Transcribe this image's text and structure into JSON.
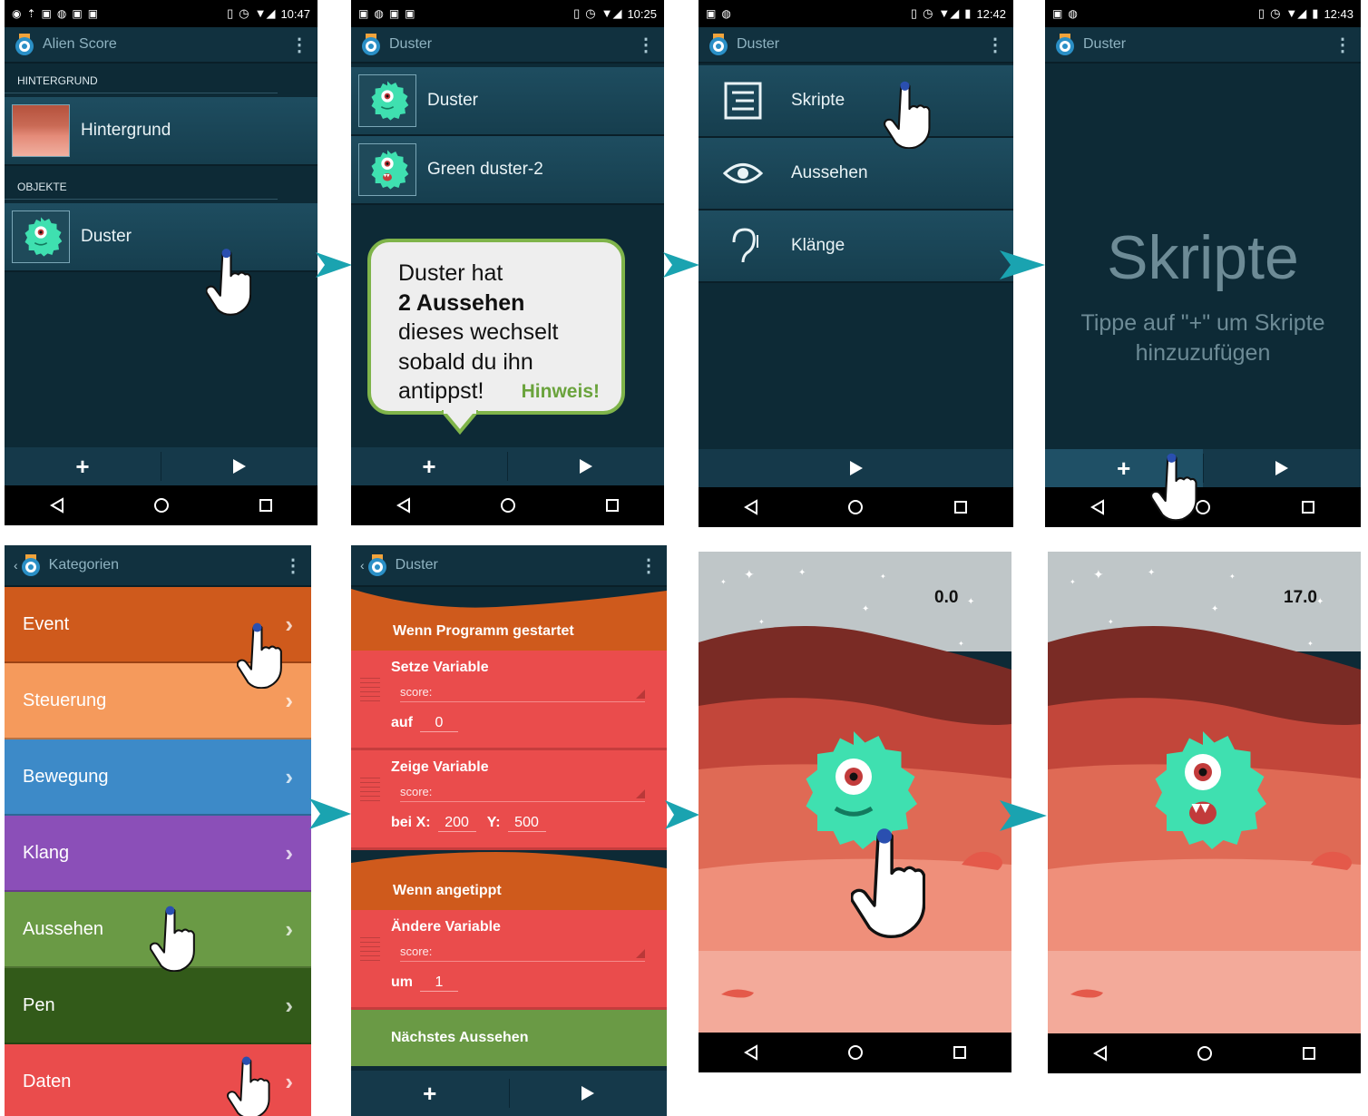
{
  "screen1": {
    "status_time": "10:47",
    "app_title": "Alien Score",
    "section_background": "HINTERGRUND",
    "background_item": "Hintergrund",
    "section_objects": "OBJEKTE",
    "object_item": "Duster"
  },
  "screen2": {
    "status_time": "10:25",
    "app_title": "Duster",
    "looks": [
      "Duster",
      "Green duster-2"
    ],
    "bubble_line1": "Duster hat",
    "bubble_bold": "2 Aussehen",
    "bubble_line3": "dieses wechselt",
    "bubble_line4": "sobald du ihn",
    "bubble_line5": "antippst!",
    "bubble_hint": "Hinweis!"
  },
  "screen3": {
    "status_time": "12:42",
    "app_title": "Duster",
    "items": [
      "Skripte",
      "Aussehen",
      "Klänge"
    ]
  },
  "screen4": {
    "status_time": "12:43",
    "app_title": "Duster",
    "empty_title": "Skripte",
    "empty_hint": "Tippe auf \"+\" um Skripte hinzuzufügen"
  },
  "screen5": {
    "app_title": "Kategorien",
    "categories": [
      "Event",
      "Steuerung",
      "Bewegung",
      "Klang",
      "Aussehen",
      "Pen",
      "Daten"
    ],
    "category_colors": [
      "#cf5a1c",
      "#f59a5c",
      "#3d8ac8",
      "#8b4fb8",
      "#6a9a45",
      "#325a19",
      "#ea4c4c"
    ]
  },
  "screen6": {
    "app_title": "Duster",
    "hat1": "Wenn Programm gestartet",
    "set_var": "Setze Variable",
    "set_var_name": "score:",
    "set_to_label": "auf",
    "set_to_value": "0",
    "show_var": "Zeige Variable",
    "show_var_name": "score:",
    "show_x_label": "bei X:",
    "show_x_value": "200",
    "show_y_label": "Y:",
    "show_y_value": "500",
    "hat2": "Wenn angetippt",
    "change_var": "Ändere Variable",
    "change_var_name": "score:",
    "change_by_label": "um",
    "change_by_value": "1",
    "next_look": "Nächstes Aussehen"
  },
  "screen7": {
    "score": "0.0"
  },
  "screen8": {
    "score": "17.0"
  }
}
